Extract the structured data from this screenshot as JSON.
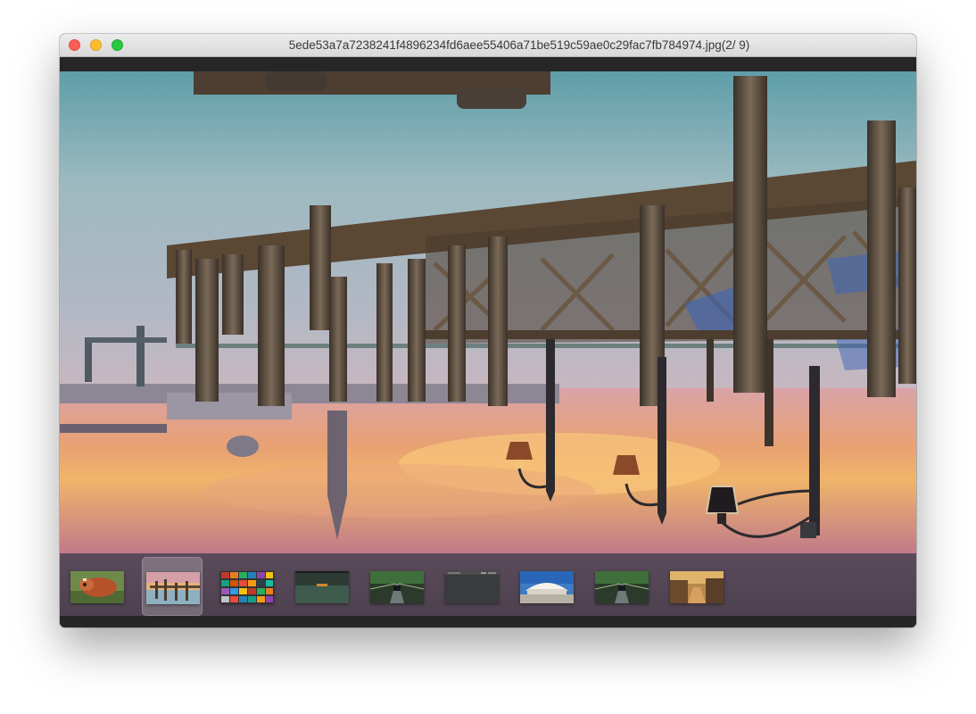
{
  "window": {
    "title": "5ede53a7a7238241f4896234fd6aee55406a71be519c59ae0c29fac7fb784974.jpg(2/ 9)",
    "controls": {
      "close_icon": "traffic-light-close",
      "minimize_icon": "traffic-light-minimize",
      "zoom_icon": "traffic-light-zoom"
    }
  },
  "viewer": {
    "image_index": 2,
    "image_count": 9,
    "rotation": "upside-down",
    "colors": {
      "sky_sunset": "#e58a5a",
      "water": "#8fb0b8",
      "wood": "#5a4734",
      "thumbstrip_bg": "#544554"
    }
  },
  "thumbnails": [
    {
      "subject": "red panda",
      "selected": false
    },
    {
      "subject": "pier at sunset",
      "selected": true
    },
    {
      "subject": "grid of colorful tiles",
      "selected": false
    },
    {
      "subject": "dark landscape",
      "selected": false
    },
    {
      "subject": "road with car",
      "selected": false
    },
    {
      "subject": "dark screenshot",
      "selected": false
    },
    {
      "subject": "modern building under blue sky",
      "selected": false
    },
    {
      "subject": "road with car",
      "selected": false
    },
    {
      "subject": "canal at golden hour",
      "selected": false
    }
  ]
}
